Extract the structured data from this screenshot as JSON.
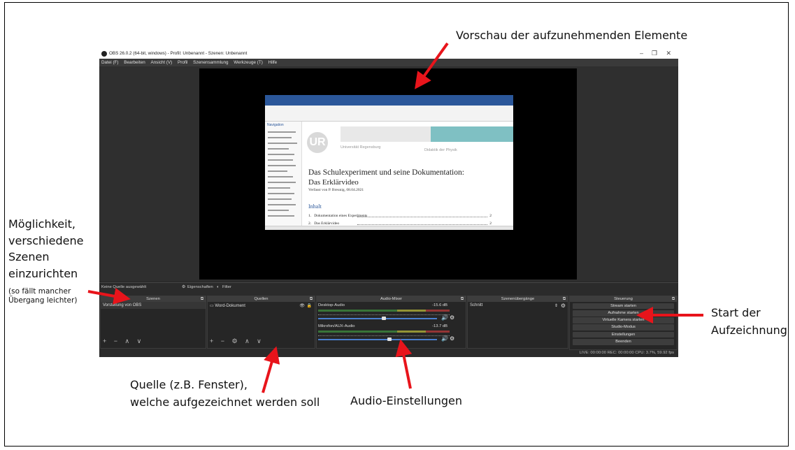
{
  "annotations": {
    "preview": "Vorschau der aufzunehmenden Elemente",
    "scenes_l1": "Möglichkeit,",
    "scenes_l2": "verschiedene",
    "scenes_l3": "Szenen",
    "scenes_l4": "einzurichten",
    "scenes_note_l1": "(so fällt mancher",
    "scenes_note_l2": "Übergang leichter)",
    "source_l1": "Quelle (z.B. Fenster),",
    "source_l2": "welche aufgezeichnet werden soll",
    "audio": "Audio-Einstellungen",
    "start_l1": "Start der",
    "start_l2": "Aufzeichnung",
    "arrow_color": "#e8141b"
  },
  "window": {
    "title": "OBS 26.0.2 (64-bit, windows) - Profil: Unbenannt - Szenen: Unbenannt",
    "minimize": "–",
    "maximize": "❐",
    "close": "✕"
  },
  "menu": [
    "Datei (F)",
    "Bearbeiten",
    "Ansicht (V)",
    "Profil",
    "Szenensammlung",
    "Werkzeuge (T)",
    "Hilfe"
  ],
  "document": {
    "nav_title": "Navigation",
    "university": "Universität Regensburg",
    "department": "Didaktik der Physik",
    "logo_text": "UR",
    "heading_l1": "Das Schulexperiment und seine Dokumentation:",
    "heading_l2": "Das Erklärvideo",
    "byline": "Verfasst von P. Breunig, 08.04.2021",
    "toc_title": "Inhalt",
    "toc": [
      {
        "num": "1.",
        "text": "Dokumentation eines Experiments",
        "page": "2"
      },
      {
        "num": "2.",
        "text": "Das Erklärvideo",
        "page": "2"
      }
    ]
  },
  "source_bar": {
    "no_source": "Keine Quelle ausgewählt",
    "properties": "Eigenschaften",
    "filters": "Filter"
  },
  "docks": {
    "scenes": {
      "title": "Szenen",
      "items": [
        "Vorstellung von OBS"
      ],
      "toolbar": "+ − ∧ ∨"
    },
    "sources": {
      "title": "Quellen",
      "items": [
        "Word-Dokument"
      ],
      "toolbar": "+ − ⚙ ∧ ∨"
    },
    "mixer": {
      "title": "Audio-Mixer",
      "channels": [
        {
          "name": "Desktop-Audio",
          "db": "-15.6 dB",
          "level": 0.55
        },
        {
          "name": "Mikrofon/AUX-Audio",
          "db": "-13.7 dB",
          "level": 0.6
        }
      ]
    },
    "transitions": {
      "title": "Szenenübergänge",
      "selected": "Schnitt"
    },
    "controls": {
      "title": "Steuerung",
      "buttons": [
        "Stream starten",
        "Aufnahme starten",
        "Virtuelle Kamera starten",
        "Studio-Modus",
        "Einstellungen",
        "Beenden"
      ]
    }
  },
  "status": "LIVE: 00:00:00   REC: 00:00:00   CPU: 3.7%, 59.92 fps"
}
